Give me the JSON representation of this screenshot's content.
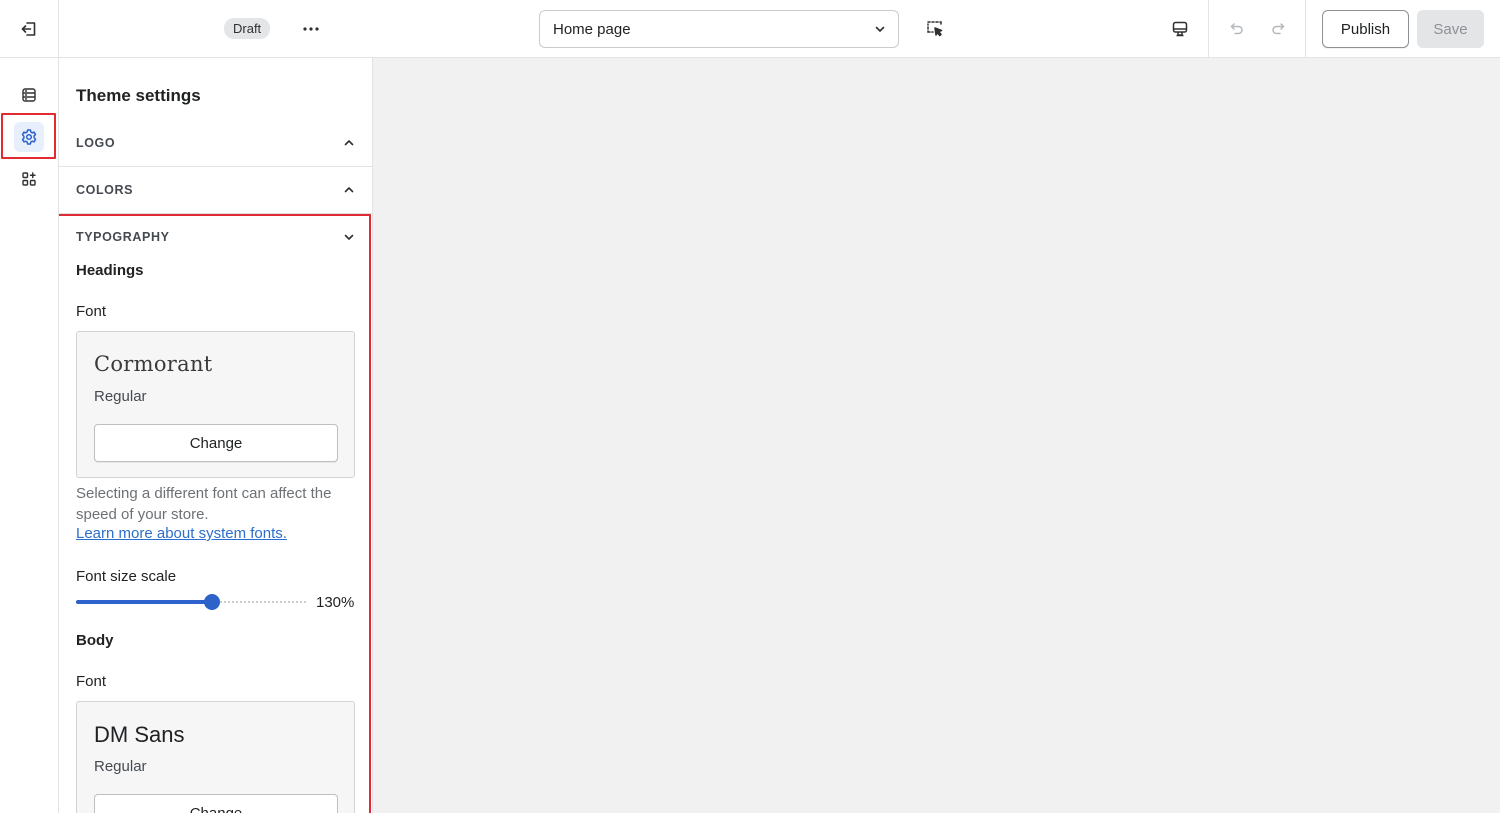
{
  "topbar": {
    "status_badge": "Draft",
    "page_selector": "Home page",
    "publish_label": "Publish",
    "save_label": "Save"
  },
  "icons": {
    "exit": "exit-icon",
    "more": "more-horizontal-icon",
    "chevron": "chevron-down-icon",
    "inspector": "select-cursor-icon",
    "device": "desktop-icon",
    "undo": "undo-icon",
    "redo": "redo-icon",
    "sections": "sections-icon",
    "settings": "gear-icon",
    "apps": "apps-icon"
  },
  "rail": {
    "active": "theme-settings"
  },
  "panel": {
    "title": "Theme settings",
    "sections": [
      {
        "name": "LOGO",
        "expanded": false
      },
      {
        "name": "COLORS",
        "expanded": false
      },
      {
        "name": "TYPOGRAPHY",
        "expanded": true
      }
    ],
    "typography": {
      "headings": {
        "title": "Headings",
        "font_label": "Font",
        "font_name": "Cormorant",
        "font_weight": "Regular",
        "change_label": "Change"
      },
      "help_text": "Selecting a different font can affect the speed of your store.",
      "help_link": "Learn more about system fonts.",
      "scale": {
        "label": "Font size scale",
        "value_text": "130%",
        "fraction": 0.59
      },
      "body": {
        "title": "Body",
        "font_label": "Font",
        "font_name": "DM Sans",
        "font_weight": "Regular",
        "change_label": "Change"
      }
    }
  },
  "colors": {
    "accent": "#2c62c9",
    "highlight": "#e02b35",
    "link": "#2c6ecb"
  }
}
